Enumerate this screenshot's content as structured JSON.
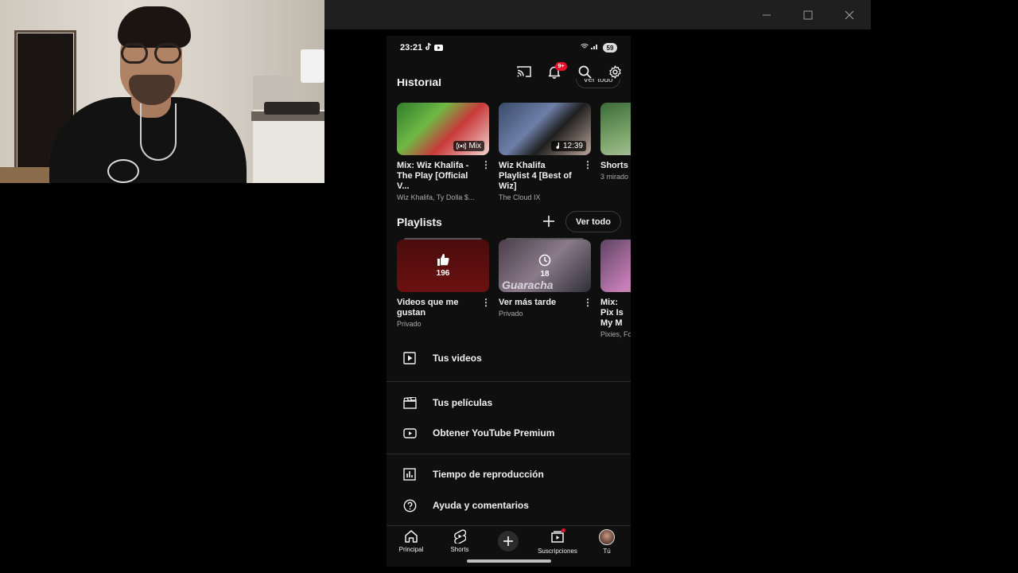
{
  "window": {
    "minimize_icon": "minimize-icon",
    "maximize_icon": "maximize-icon",
    "close_icon": "close-icon"
  },
  "status_bar": {
    "time": "23:21",
    "battery": "59"
  },
  "top_bar": {
    "notification_badge": "9+"
  },
  "history": {
    "title": "Historial",
    "see_all": "Ver todo",
    "items": [
      {
        "title": "Mix: Wiz Khalifa - The Play [Official V...",
        "subtitle": "Wiz Khalifa, Ty Dolla $...",
        "badge": "Mix"
      },
      {
        "title": "Wiz Khalifa Playlist 4 [Best of Wiz]",
        "subtitle": "The Cloud IX",
        "badge": "12:39"
      },
      {
        "title": "Shorts",
        "subtitle": "3 mirado"
      }
    ]
  },
  "playlists": {
    "title": "Playlists",
    "see_all": "Ver todo",
    "items": [
      {
        "title": "Videos que me gustan",
        "subtitle": "Privado",
        "count": "196"
      },
      {
        "title": "Ver más tarde",
        "subtitle": "Privado",
        "count": "18",
        "thumb_text": "Guaracha"
      },
      {
        "title": "Mix: Pix Is My M",
        "subtitle": "Pixies, Fo"
      }
    ]
  },
  "menu": {
    "your_videos": "Tus videos",
    "your_movies": "Tus películas",
    "get_premium": "Obtener YouTube Premium",
    "watch_time": "Tiempo de reproducción",
    "help": "Ayuda y comentarios"
  },
  "bottom_nav": {
    "home": "Principal",
    "shorts": "Shorts",
    "subscriptions": "Suscripciones",
    "you": "Tú"
  },
  "colors": {
    "background": "#0f0f0f",
    "accent_red": "#e8112d",
    "text": "#f1f1f1",
    "muted": "#aaaaaa"
  }
}
